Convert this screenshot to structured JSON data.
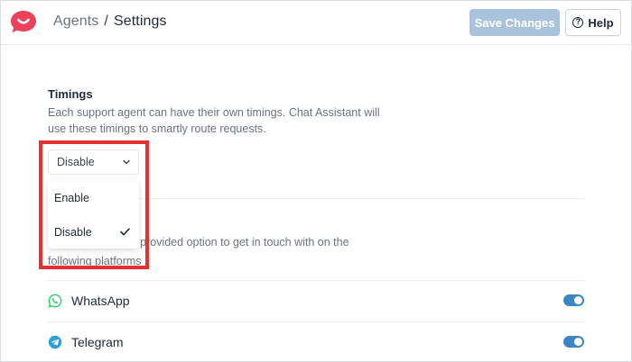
{
  "header": {
    "breadcrumb_parent": "Agents",
    "breadcrumb_separator": "/",
    "breadcrumb_current": "Settings",
    "save_label": "Save Changes",
    "help_label": "Help",
    "help_icon_glyph": "?"
  },
  "timings": {
    "title": "Timings",
    "description": "Each support agent can have their own timings. Chat Assistant will use these timings to smartly route requests.",
    "selected_value": "Disable",
    "options": [
      "Enable",
      "Disable"
    ]
  },
  "platforms": {
    "description_visible": "be provided option to get in touch with on the following platforms",
    "items": [
      {
        "label": "WhatsApp",
        "enabled": true,
        "icon": "whatsapp-icon",
        "color": "#25D366"
      },
      {
        "label": "Telegram",
        "enabled": true,
        "icon": "telegram-icon",
        "color": "#2AA1DA"
      }
    ]
  },
  "colors": {
    "brand": "#E8435A",
    "save_button": "#A9C3DC",
    "toggle_on": "#3B86C4",
    "highlight": "#E53030"
  }
}
